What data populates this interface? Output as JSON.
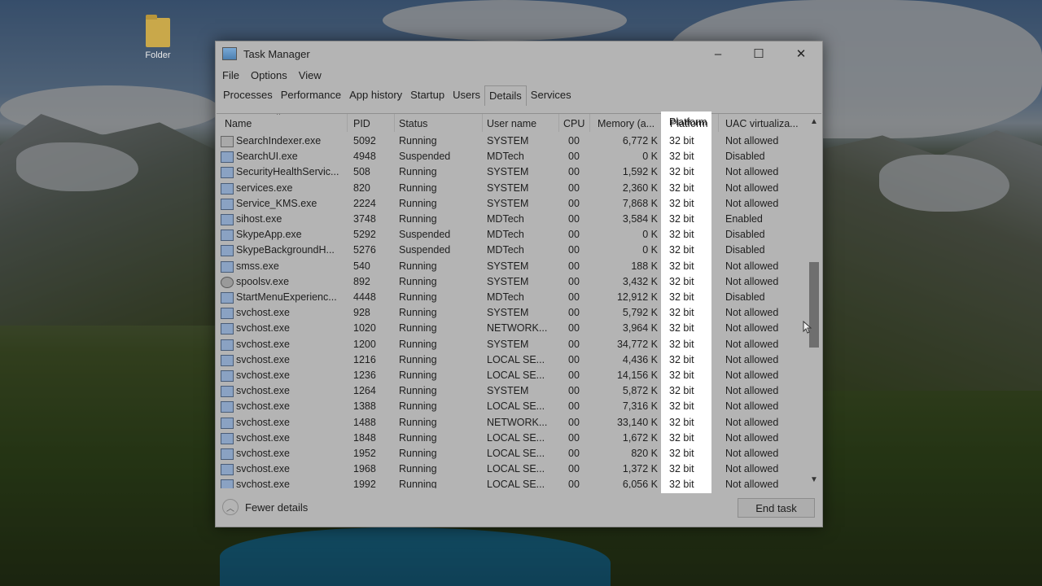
{
  "desktop": {
    "icon_label": "Folder"
  },
  "window": {
    "title": "Task Manager",
    "menu": [
      "File",
      "Options",
      "View"
    ],
    "tabs": [
      "Processes",
      "Performance",
      "App history",
      "Startup",
      "Users",
      "Details",
      "Services"
    ],
    "active_tab": "Details",
    "columns": [
      "Name",
      "PID",
      "Status",
      "User name",
      "CPU",
      "Memory (a...",
      "Platform",
      "UAC virtualiza..."
    ],
    "rows": [
      {
        "name": "SearchIndexer.exe",
        "pid": "5092",
        "status": "Running",
        "user": "SYSTEM",
        "cpu": "00",
        "mem": "6,772 K",
        "platform": "32 bit",
        "uac": "Not allowed",
        "icon": "search-icon"
      },
      {
        "name": "SearchUI.exe",
        "pid": "4948",
        "status": "Suspended",
        "user": "MDTech",
        "cpu": "00",
        "mem": "0 K",
        "platform": "32 bit",
        "uac": "Disabled",
        "icon": "app-icon"
      },
      {
        "name": "SecurityHealthServic...",
        "pid": "508",
        "status": "Running",
        "user": "SYSTEM",
        "cpu": "00",
        "mem": "1,592 K",
        "platform": "32 bit",
        "uac": "Not allowed",
        "icon": "app-icon"
      },
      {
        "name": "services.exe",
        "pid": "820",
        "status": "Running",
        "user": "SYSTEM",
        "cpu": "00",
        "mem": "2,360 K",
        "platform": "32 bit",
        "uac": "Not allowed",
        "icon": "app-icon"
      },
      {
        "name": "Service_KMS.exe",
        "pid": "2224",
        "status": "Running",
        "user": "SYSTEM",
        "cpu": "00",
        "mem": "7,868 K",
        "platform": "32 bit",
        "uac": "Not allowed",
        "icon": "app-icon"
      },
      {
        "name": "sihost.exe",
        "pid": "3748",
        "status": "Running",
        "user": "MDTech",
        "cpu": "00",
        "mem": "3,584 K",
        "platform": "32 bit",
        "uac": "Enabled",
        "icon": "app-icon"
      },
      {
        "name": "SkypeApp.exe",
        "pid": "5292",
        "status": "Suspended",
        "user": "MDTech",
        "cpu": "00",
        "mem": "0 K",
        "platform": "32 bit",
        "uac": "Disabled",
        "icon": "app-icon"
      },
      {
        "name": "SkypeBackgroundH...",
        "pid": "5276",
        "status": "Suspended",
        "user": "MDTech",
        "cpu": "00",
        "mem": "0 K",
        "platform": "32 bit",
        "uac": "Disabled",
        "icon": "app-icon"
      },
      {
        "name": "smss.exe",
        "pid": "540",
        "status": "Running",
        "user": "SYSTEM",
        "cpu": "00",
        "mem": "188 K",
        "platform": "32 bit",
        "uac": "Not allowed",
        "icon": "app-icon"
      },
      {
        "name": "spoolsv.exe",
        "pid": "892",
        "status": "Running",
        "user": "SYSTEM",
        "cpu": "00",
        "mem": "3,432 K",
        "platform": "32 bit",
        "uac": "Not allowed",
        "icon": "printer-icon"
      },
      {
        "name": "StartMenuExperienc...",
        "pid": "4448",
        "status": "Running",
        "user": "MDTech",
        "cpu": "00",
        "mem": "12,912 K",
        "platform": "32 bit",
        "uac": "Disabled",
        "icon": "app-icon"
      },
      {
        "name": "svchost.exe",
        "pid": "928",
        "status": "Running",
        "user": "SYSTEM",
        "cpu": "00",
        "mem": "5,792 K",
        "platform": "32 bit",
        "uac": "Not allowed",
        "icon": "app-icon"
      },
      {
        "name": "svchost.exe",
        "pid": "1020",
        "status": "Running",
        "user": "NETWORK...",
        "cpu": "00",
        "mem": "3,964 K",
        "platform": "32 bit",
        "uac": "Not allowed",
        "icon": "app-icon"
      },
      {
        "name": "svchost.exe",
        "pid": "1200",
        "status": "Running",
        "user": "SYSTEM",
        "cpu": "00",
        "mem": "34,772 K",
        "platform": "32 bit",
        "uac": "Not allowed",
        "icon": "app-icon"
      },
      {
        "name": "svchost.exe",
        "pid": "1216",
        "status": "Running",
        "user": "LOCAL SE...",
        "cpu": "00",
        "mem": "4,436 K",
        "platform": "32 bit",
        "uac": "Not allowed",
        "icon": "app-icon"
      },
      {
        "name": "svchost.exe",
        "pid": "1236",
        "status": "Running",
        "user": "LOCAL SE...",
        "cpu": "00",
        "mem": "14,156 K",
        "platform": "32 bit",
        "uac": "Not allowed",
        "icon": "app-icon"
      },
      {
        "name": "svchost.exe",
        "pid": "1264",
        "status": "Running",
        "user": "SYSTEM",
        "cpu": "00",
        "mem": "5,872 K",
        "platform": "32 bit",
        "uac": "Not allowed",
        "icon": "app-icon"
      },
      {
        "name": "svchost.exe",
        "pid": "1388",
        "status": "Running",
        "user": "LOCAL SE...",
        "cpu": "00",
        "mem": "7,316 K",
        "platform": "32 bit",
        "uac": "Not allowed",
        "icon": "app-icon"
      },
      {
        "name": "svchost.exe",
        "pid": "1488",
        "status": "Running",
        "user": "NETWORK...",
        "cpu": "00",
        "mem": "33,140 K",
        "platform": "32 bit",
        "uac": "Not allowed",
        "icon": "app-icon"
      },
      {
        "name": "svchost.exe",
        "pid": "1848",
        "status": "Running",
        "user": "LOCAL SE...",
        "cpu": "00",
        "mem": "1,672 K",
        "platform": "32 bit",
        "uac": "Not allowed",
        "icon": "app-icon"
      },
      {
        "name": "svchost.exe",
        "pid": "1952",
        "status": "Running",
        "user": "LOCAL SE...",
        "cpu": "00",
        "mem": "820 K",
        "platform": "32 bit",
        "uac": "Not allowed",
        "icon": "app-icon"
      },
      {
        "name": "svchost.exe",
        "pid": "1968",
        "status": "Running",
        "user": "LOCAL SE...",
        "cpu": "00",
        "mem": "1,372 K",
        "platform": "32 bit",
        "uac": "Not allowed",
        "icon": "app-icon"
      },
      {
        "name": "svchost.exe",
        "pid": "1992",
        "status": "Running",
        "user": "LOCAL SE...",
        "cpu": "00",
        "mem": "6,056 K",
        "platform": "32 bit",
        "uac": "Not allowed",
        "icon": "app-icon"
      }
    ],
    "footer": {
      "fewer_details": "Fewer details",
      "end_task": "End task"
    },
    "highlight_column": "Platform",
    "highlight_color": "#ffffff"
  }
}
